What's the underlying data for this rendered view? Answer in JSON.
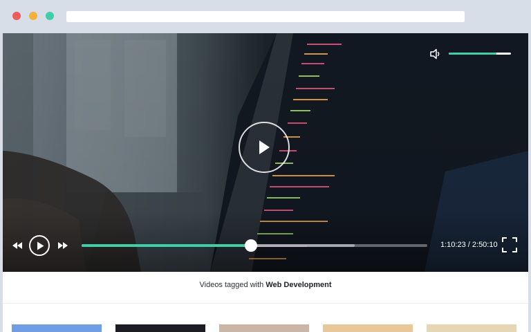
{
  "window": {
    "controls": [
      {
        "name": "close",
        "color": "#ee5b5b"
      },
      {
        "name": "minimize",
        "color": "#f5b13d"
      },
      {
        "name": "maximize",
        "color": "#3fcea6"
      }
    ],
    "address": ""
  },
  "player": {
    "progress": 0.49,
    "buffered": 0.79,
    "volume": 0.77,
    "current_time": "1:10:23",
    "separator": "/",
    "duration": "2:50:10",
    "accent": "#3fcea6"
  },
  "tagline": {
    "prefix": "Videos tagged with",
    "tag": "Web Development"
  },
  "related": [
    {
      "name": "video-thumbnail-1",
      "color": "#6f9ee6"
    },
    {
      "name": "video-thumbnail-2",
      "color": "#1b1d22"
    },
    {
      "name": "video-thumbnail-3",
      "color": "#c9b6a6"
    },
    {
      "name": "video-thumbnail-4",
      "color": "#e8c79a"
    },
    {
      "name": "video-thumbnail-5",
      "color": "#e6d7b4"
    }
  ]
}
